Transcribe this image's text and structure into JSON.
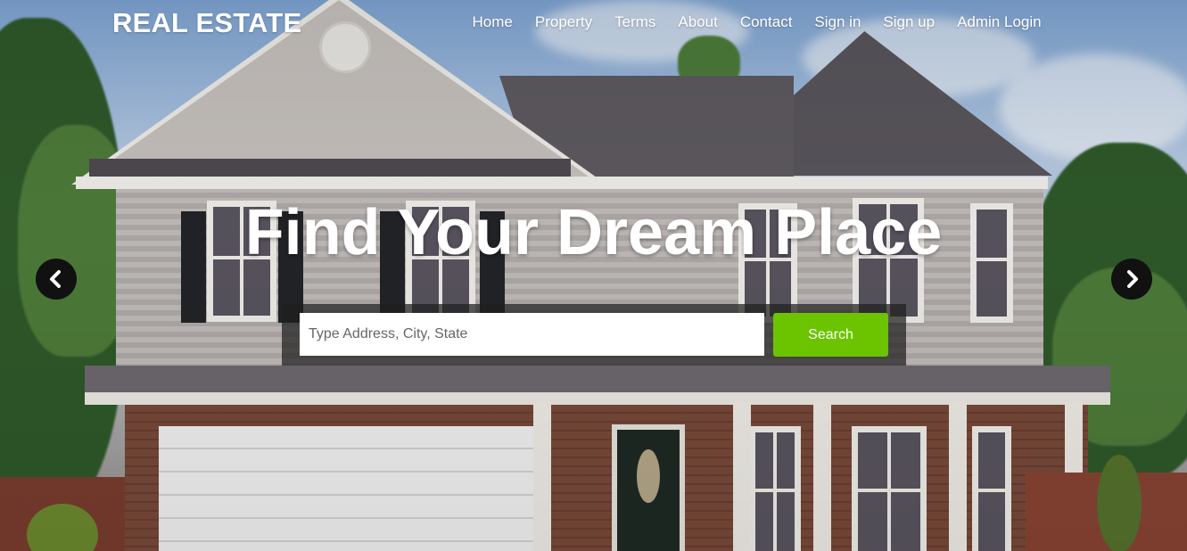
{
  "brand": "REAL ESTATE",
  "nav": {
    "items": [
      {
        "label": "Home"
      },
      {
        "label": "Property"
      },
      {
        "label": "Terms"
      },
      {
        "label": "About"
      },
      {
        "label": "Contact"
      },
      {
        "label": "Sign in"
      },
      {
        "label": "Sign up"
      },
      {
        "label": "Admin Login"
      }
    ]
  },
  "hero": {
    "headline": "Find Your Dream Place",
    "search": {
      "placeholder": "Type Address, City, State",
      "value": "",
      "button_label": "Search"
    },
    "carousel": {
      "prev_icon": "chevron-left-icon",
      "next_icon": "chevron-right-icon"
    }
  },
  "colors": {
    "search_button": "#6cc400",
    "arrow_bg": "#111111",
    "text": "#ffffff"
  }
}
